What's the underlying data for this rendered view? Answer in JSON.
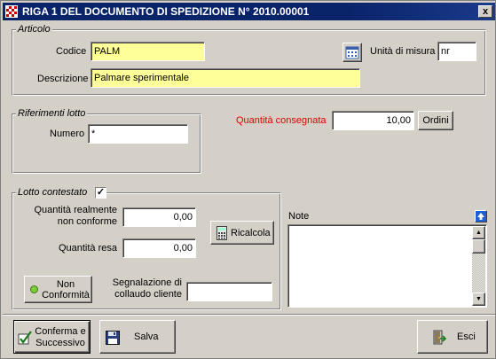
{
  "window": {
    "title": "RIGA 1 DEL DOCUMENTO DI SPEDIZIONE N° 2010.00001",
    "close_label": "x"
  },
  "articolo": {
    "legend": "Articolo",
    "codice_label": "Codice",
    "codice_value": "PALM",
    "descrizione_label": "Descrizione",
    "descrizione_value": "Palmare sperimentale",
    "unita_label": "Unità di misura",
    "unita_value": "nr"
  },
  "lotto": {
    "legend": "Riferimenti lotto",
    "numero_label": "Numero",
    "numero_value": "*"
  },
  "consegna": {
    "label": "Quantità consegnata",
    "value": "10,00",
    "ordini_label": "Ordini"
  },
  "contestato": {
    "legend": "Lotto contestato",
    "checked": "✓",
    "qty_nonconforme_label_1": "Quantità realmente",
    "qty_nonconforme_label_2": "non conforme",
    "qty_nonconforme_value": "0,00",
    "qty_resa_label": "Quantità resa",
    "qty_resa_value": "0,00",
    "ricalcola_label": "Ricalcola",
    "non_conf_label_1": "Non",
    "non_conf_label_2": "Conformità",
    "segnalazione_label_1": "Segnalazione di",
    "segnalazione_label_2": "collaudo cliente",
    "segnalazione_value": ""
  },
  "note": {
    "label": "Note",
    "value": ""
  },
  "footer": {
    "conferma_label_1": "Conferma e",
    "conferma_label_2": "Successivo",
    "salva_label": "Salva",
    "esci_label": "Esci"
  }
}
